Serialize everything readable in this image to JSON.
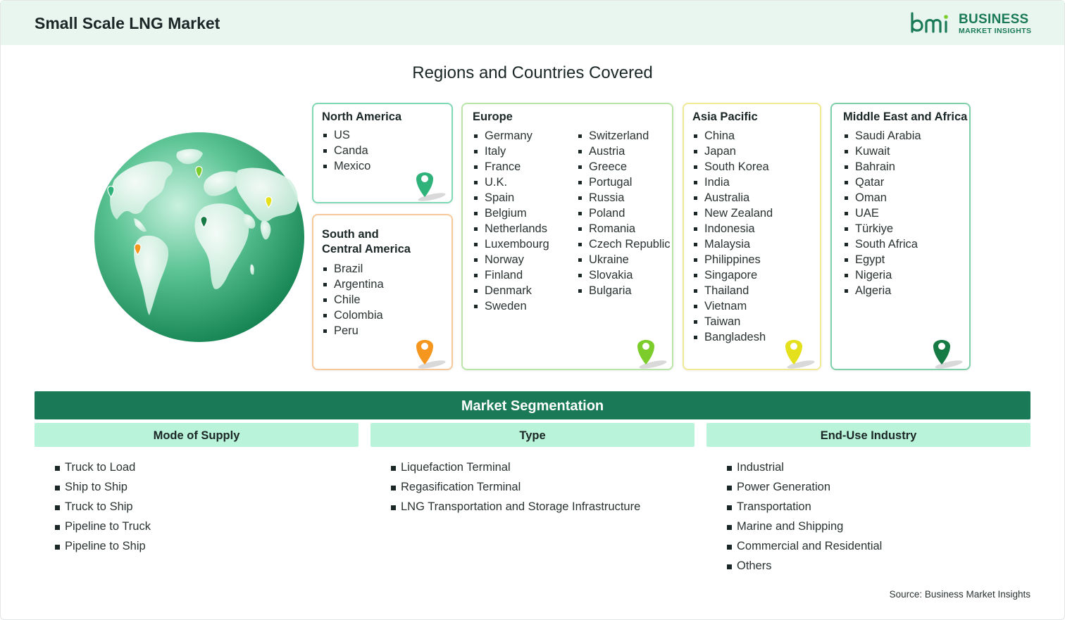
{
  "header": {
    "title": "Small Scale LNG Market",
    "logo_line1": "BUSINESS",
    "logo_line2": "MARKET INSIGHTS",
    "logo_mark": "bmi",
    "brand_color": "#1a7a58",
    "background_color": "#e9f6f0"
  },
  "regions": {
    "title": "Regions and Countries Covered",
    "north_america": {
      "name": "North America",
      "countries": [
        "US",
        "Canda",
        "Mexico"
      ],
      "border_color": "#7fd9b4",
      "pin_color": "#2fb37a"
    },
    "south_central_america": {
      "name_line1": "South and",
      "name_line2": "Central America",
      "countries": [
        "Brazil",
        "Argentina",
        "Chile",
        "Colombia",
        "Peru"
      ],
      "border_color": "#f7c99a",
      "pin_color": "#f5961f"
    },
    "europe": {
      "name": "Europe",
      "countries_col1": [
        "Germany",
        "Italy",
        "France",
        "U.K.",
        "Spain",
        "Belgium",
        "Netherlands",
        "Luxembourg",
        "Norway",
        "Finland",
        "Denmark",
        "Sweden"
      ],
      "countries_col2": [
        "Switzerland",
        "Austria",
        "Greece",
        "Portugal",
        "Russia",
        "Poland",
        "Romania",
        "Czech Republic",
        "Ukraine",
        "Slovakia",
        "Bulgaria"
      ],
      "border_color": "#b9e6a8",
      "pin_color": "#7ccc2c"
    },
    "asia_pacific": {
      "name": "Asia Pacific",
      "countries": [
        "China",
        "Japan",
        "South Korea",
        "India",
        "Australia",
        "New Zealand",
        "Indonesia",
        "Malaysia",
        "Philippines",
        "Singapore",
        "Thailand",
        "Vietnam",
        "Taiwan",
        "Bangladesh"
      ],
      "border_color": "#f1ea95",
      "pin_color": "#e4e01c"
    },
    "middle_east_africa": {
      "name": "Middle East and Africa",
      "countries": [
        "Saudi Arabia",
        "Kuwait",
        "Bahrain",
        "Qatar",
        "Oman",
        "UAE",
        "Türkiye",
        "South Africa",
        "Egypt",
        "Nigeria",
        "Algeria"
      ],
      "border_color": "#7fd0aa",
      "pin_color": "#167a45"
    }
  },
  "segmentation": {
    "title": "Market Segmentation",
    "mode_of_supply": {
      "label": "Mode of Supply",
      "items": [
        "Truck to Load",
        "Ship to Ship",
        "Truck to Ship",
        "Pipeline to Truck",
        "Pipeline to Ship"
      ]
    },
    "type": {
      "label": "Type",
      "items": [
        "Liquefaction Terminal",
        "Regasification Terminal",
        "LNG Transportation and Storage Infrastructure"
      ]
    },
    "end_use_industry": {
      "label": "End-Use Industry",
      "items": [
        "Industrial",
        "Power Generation",
        "Transportation",
        "Marine and Shipping",
        "Commercial and Residential",
        "Others"
      ]
    }
  },
  "footer": {
    "source": "Source: Business Market Insights"
  },
  "icons": [
    "globe-icon",
    "location-pin-icon",
    "bmi-logo-icon"
  ]
}
